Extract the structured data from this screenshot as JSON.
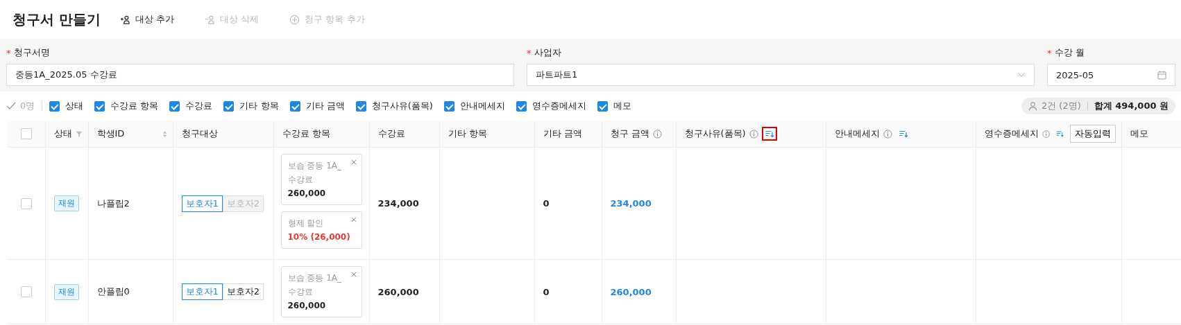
{
  "title": "청구서 만들기",
  "actions": [
    {
      "label": "대상 추가",
      "disabled": false
    },
    {
      "label": "대상 삭제",
      "disabled": true
    },
    {
      "label": "청구 항목 추가",
      "disabled": true
    }
  ],
  "form_fields": [
    {
      "label": "청구서명",
      "required_mark": "*",
      "value": "중등1A_2025.05 수강료",
      "kind": "text"
    },
    {
      "label": "사업자",
      "required_mark": "*",
      "value": "파트파트1",
      "kind": "select"
    },
    {
      "label": "수강 월",
      "required_mark": "*",
      "value": "2025-05",
      "kind": "date"
    }
  ],
  "selection_count": "0명",
  "column_toggles": [
    {
      "label": "상태",
      "checked": true
    },
    {
      "label": "수강료 항목",
      "checked": true
    },
    {
      "label": "수강료",
      "checked": true
    },
    {
      "label": "기타 항목",
      "checked": true
    },
    {
      "label": "기타 금액",
      "checked": true
    },
    {
      "label": "청구사유(품목)",
      "checked": true
    },
    {
      "label": "안내메세지",
      "checked": true
    },
    {
      "label": "영수증메세지",
      "checked": true
    },
    {
      "label": "메모",
      "checked": true
    }
  ],
  "summary": {
    "count": "2건 (2명)",
    "total": "합계 494,000 원"
  },
  "table": {
    "all_checked": false,
    "columns": [
      {
        "label": "상태",
        "filter": true
      },
      {
        "label": "학생ID",
        "sortable": true
      },
      {
        "label": "청구대상"
      },
      {
        "label": "수강료 항목"
      },
      {
        "label": "수강료"
      },
      {
        "label": "기타 항목"
      },
      {
        "label": "기타 금액"
      },
      {
        "label": "청구 금액",
        "info": true
      },
      {
        "label": "청구사유(품목)",
        "info": true,
        "order": true,
        "highlighted": true
      },
      {
        "label": "안내메세지",
        "info": true,
        "order": true,
        "highlighted": false
      },
      {
        "label": "영수증메세지",
        "info": true,
        "order": true,
        "highlighted": false,
        "button": "자동입력"
      },
      {
        "label": "메모"
      }
    ],
    "rows": [
      {
        "checked": false,
        "status": "재원",
        "student_id": "나플립2",
        "targets": [
          {
            "label": "보호자1",
            "selected": true,
            "disabled": false
          },
          {
            "label": "보호자2",
            "selected": false,
            "disabled": true
          }
        ],
        "fee_items": [
          {
            "name": "보습 중등 1A_수강료",
            "amount": "260,000",
            "kind": "fee"
          },
          {
            "name": "형제 할인",
            "amount": "10% (26,000)",
            "kind": "discount"
          }
        ],
        "tuition": "234,000",
        "other_amount": "0",
        "billed": "234,000"
      },
      {
        "checked": false,
        "status": "재원",
        "student_id": "안플립0",
        "targets": [
          {
            "label": "보호자1",
            "selected": true,
            "disabled": false
          },
          {
            "label": "보호자2",
            "selected": false,
            "disabled": false
          }
        ],
        "fee_items": [
          {
            "name": "보습 중등 1A_수강료",
            "amount": "260,000",
            "kind": "fee"
          }
        ],
        "tuition": "260,000",
        "other_amount": "0",
        "billed": "260,000"
      }
    ]
  }
}
